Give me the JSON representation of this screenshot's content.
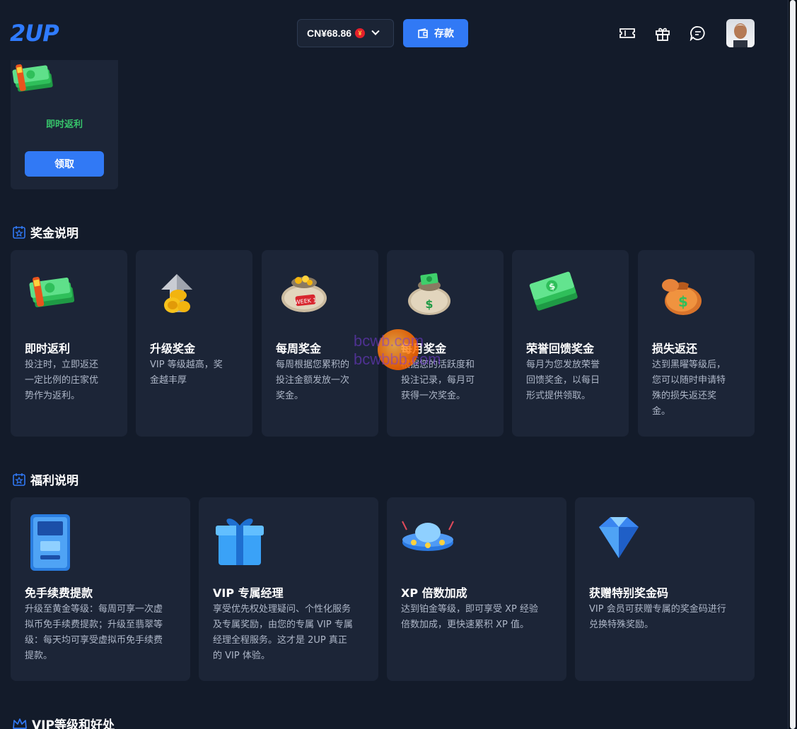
{
  "header": {
    "logo": "2UP",
    "balance": "CN¥68.86",
    "currency_symbol": "¥",
    "deposit_label": "存款",
    "icons": [
      "ticket-icon",
      "gift-icon",
      "chat-icon"
    ]
  },
  "top_card": {
    "label": "即时返利",
    "button": "领取"
  },
  "bonus_section": {
    "title": "奖金说明",
    "cards": [
      {
        "title": "即时返利",
        "desc": [
          "投注时，立即返还",
          "一定比例的庄家优",
          "势作为返利。"
        ]
      },
      {
        "title": "升级奖金",
        "desc": [
          "VIP 等级越高，奖",
          "金越丰厚"
        ]
      },
      {
        "title": "每周奖金",
        "desc": [
          "每周根据您累积的",
          "投注金额发放一次",
          "奖金。"
        ]
      },
      {
        "title": "每月奖金",
        "desc": [
          "根据您的活跃度和",
          "投注记录，每月可",
          "获得一次奖金。"
        ]
      },
      {
        "title": "荣誉回馈奖金",
        "desc": [
          "每月为您发放荣誉",
          "回馈奖金，以每日",
          "形式提供领取。"
        ]
      },
      {
        "title": "损失返还",
        "desc": [
          "达到黑曜等级后，",
          "您可以随时申请特",
          "殊的损失返还奖",
          "金。"
        ]
      }
    ]
  },
  "welfare_section": {
    "title": "福利说明",
    "cards": [
      {
        "title": "免手续费提款",
        "desc": [
          "升级至黄金等级：每周可享一次虚",
          "拟币免手续费提款；升级至翡翠等",
          "级：每天均可享受虚拟币免手续费",
          "提款。"
        ]
      },
      {
        "title": "VIP 专属经理",
        "desc": [
          "享受优先权处理疑问、个性化服务",
          "及专属奖励，由您的专属 VIP 专属",
          "经理全程服务。这才是 2UP 真正",
          "的 VIP 体验。"
        ]
      },
      {
        "title": "XP 倍数加成",
        "desc": [
          "达到铂金等级，即可享受 XP 经验",
          "倍数加成，更快速累积 XP 值。"
        ]
      },
      {
        "title": "获赠特别奖金码",
        "desc": [
          "VIP 会员可获赠专属的奖金码进行",
          "兑换特殊奖励。"
        ]
      }
    ]
  },
  "vip_section": {
    "title": "VIP等级和好处"
  },
  "watermark": [
    "bcwb.com",
    "bcwbbb.com"
  ],
  "colors": {
    "accent": "#3179f5",
    "green": "#37c46b",
    "card_bg": "#1c2537",
    "page_bg": "#131b2a"
  }
}
